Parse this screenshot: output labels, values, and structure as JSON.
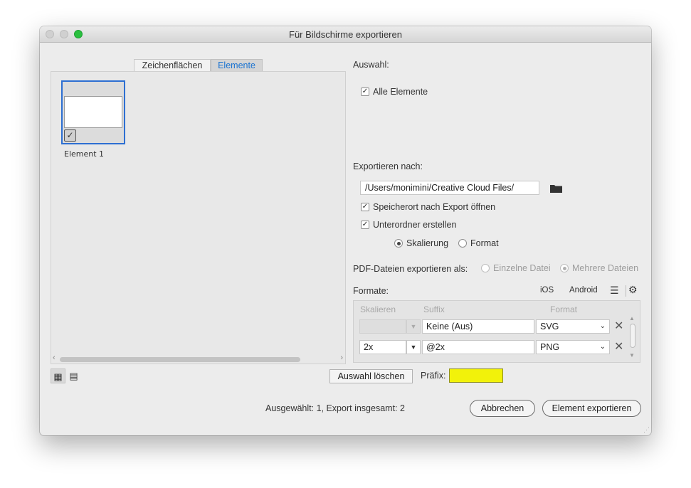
{
  "window": {
    "title": "Für Bildschirme exportieren"
  },
  "tabs": [
    {
      "label": "Zeichenflächen",
      "active": false
    },
    {
      "label": "Elemente",
      "active": true
    }
  ],
  "assets": [
    {
      "label": "Element 1",
      "selected": true,
      "checked": true
    }
  ],
  "selection": {
    "heading": "Auswahl:",
    "all_elements_label": "Alle Elemente",
    "all_elements_checked": true
  },
  "export_to": {
    "heading": "Exportieren nach:",
    "path": "/Users/monimini/Creative Cloud Files/",
    "open_location_label": "Speicherort nach Export öffnen",
    "open_location_checked": true,
    "subfolders_label": "Unterordner erstellen",
    "subfolders_checked": true,
    "subfolder_by": [
      {
        "label": "Skalierung",
        "selected": true
      },
      {
        "label": "Format",
        "selected": false
      }
    ]
  },
  "pdf": {
    "label": "PDF-Dateien exportieren als:",
    "options": [
      {
        "label": "Einzelne Datei",
        "selected": false
      },
      {
        "label": "Mehrere Dateien",
        "selected": true
      }
    ]
  },
  "formats": {
    "heading": "Formate:",
    "presets": {
      "ios": "iOS",
      "android": "Android"
    },
    "columns": {
      "scale": "Skalieren",
      "suffix": "Suffix",
      "format": "Format"
    },
    "rows": [
      {
        "scale": "",
        "suffix": "Keine (Aus)",
        "format": "SVG"
      },
      {
        "scale": "2x",
        "suffix": "@2x",
        "format": "PNG"
      }
    ]
  },
  "footer": {
    "clear_selection": "Auswahl löschen",
    "prefix_label": "Präfix:",
    "prefix_value": "",
    "prefix_highlight_color": "#f2f20a",
    "status": "Ausgewählt: 1, Export insgesamt: 2",
    "cancel": "Abbrechen",
    "export": "Element exportieren"
  },
  "colors": {
    "accent_blue": "#2d6fd2",
    "tab_active_text": "#1a73d1",
    "traffic_green": "#2ac03f"
  },
  "icons": {
    "check": "✓",
    "dropdown_arrow": "▼",
    "chevron": "⌄",
    "remove": "✕",
    "list": "☰",
    "gear": "⚙",
    "grid_view": "▦",
    "list_view": "▤",
    "scroll_left": "‹",
    "scroll_right": "›",
    "scroll_up": "▲",
    "scroll_down": "▼",
    "resize": "⋰"
  }
}
